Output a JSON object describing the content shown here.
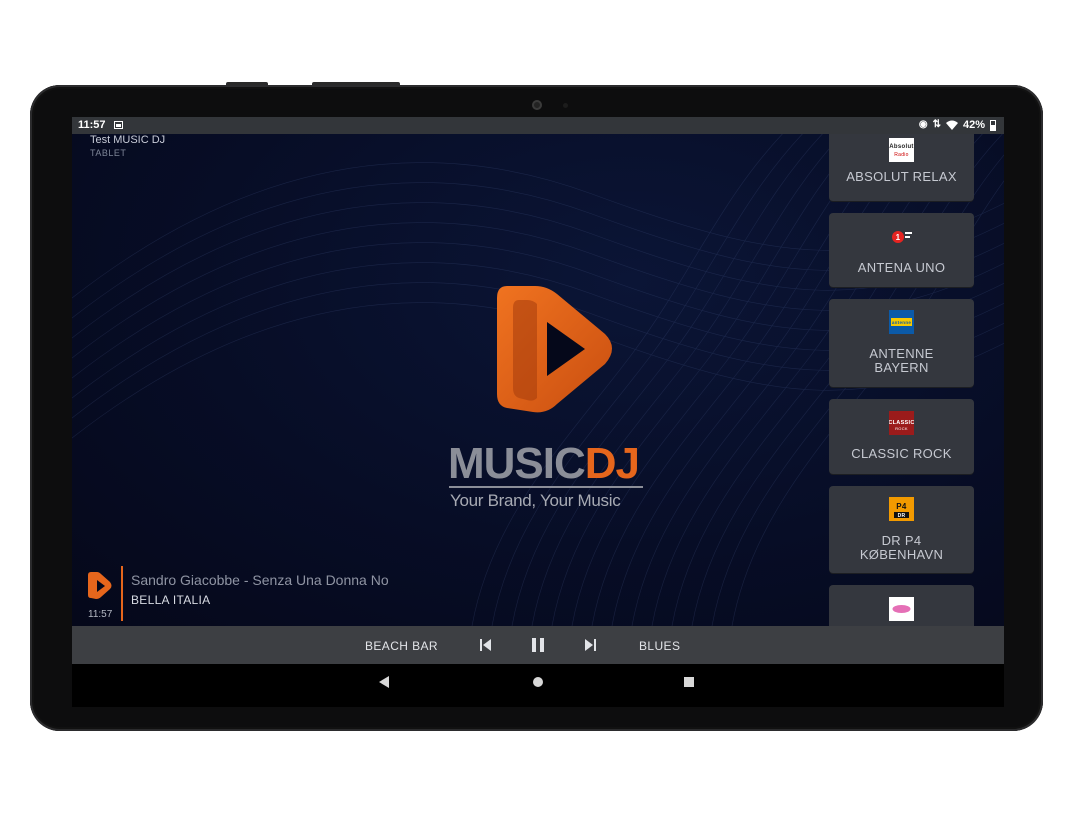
{
  "status_bar": {
    "time": "11:57",
    "battery": "42%"
  },
  "app": {
    "title": "Test MUSIC DJ",
    "device_type": "TABLET"
  },
  "brand": {
    "word_gray": "MUSIC",
    "word_orange": "DJ",
    "tagline": "Your Brand, Your Music",
    "accent_color": "#e6661c"
  },
  "now_playing": {
    "time": "11:57",
    "track": "Sandro Giacobbe - Senza Una Donna No",
    "channel": "BELLA ITALIA"
  },
  "stations": [
    {
      "name": "ABSOLUT RELAX",
      "logo_text": "Absolut Radio"
    },
    {
      "name": "ANTENA UNO",
      "logo_text": "1"
    },
    {
      "name": "ANTENNE BAYERN",
      "logo_text": "antenne bayern"
    },
    {
      "name": "CLASSIC ROCK",
      "logo_text": "CLASSIC ROCK"
    },
    {
      "name": "DR P4 KØBENHAVN",
      "logo_text": "P4 DR"
    },
    {
      "name": "",
      "logo_text": ""
    }
  ],
  "controls": {
    "previous_channel": "BEACH BAR",
    "next_channel": "BLUES",
    "icons": [
      "skip-previous-icon",
      "pause-icon",
      "skip-next-icon"
    ]
  }
}
